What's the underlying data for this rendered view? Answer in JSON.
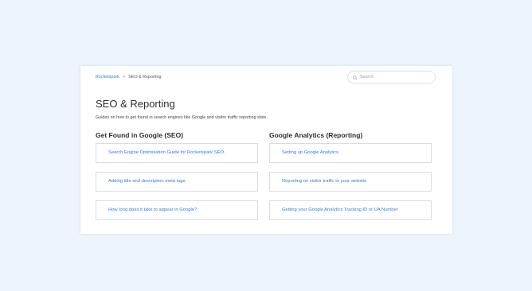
{
  "breadcrumb": {
    "home": "Rocketspark",
    "separator": ">",
    "current": "SEO & Reporting"
  },
  "search": {
    "placeholder": "Search"
  },
  "page": {
    "title": "SEO & Reporting",
    "description": "Guides on how to get found in search engines like Google and visitor traffic reporting stats."
  },
  "sections": [
    {
      "title": "Get Found in Google (SEO)",
      "articles": [
        "Search Engine Optimisation Guide for Rocketspark SEO.",
        "Adding title and description meta tags",
        "How long does it take to appear in Google?"
      ]
    },
    {
      "title": "Google Analytics (Reporting)",
      "articles": [
        "Setting up Google Analytics",
        "Reporting on visitor traffic to your website",
        "Getting your Google Analytics Tracking ID or UA Number"
      ]
    }
  ],
  "colors": {
    "background": "#eef4fb",
    "link": "#2f7ed8",
    "text": "#2d2d2d"
  },
  "icons": {
    "search": "search-icon"
  }
}
